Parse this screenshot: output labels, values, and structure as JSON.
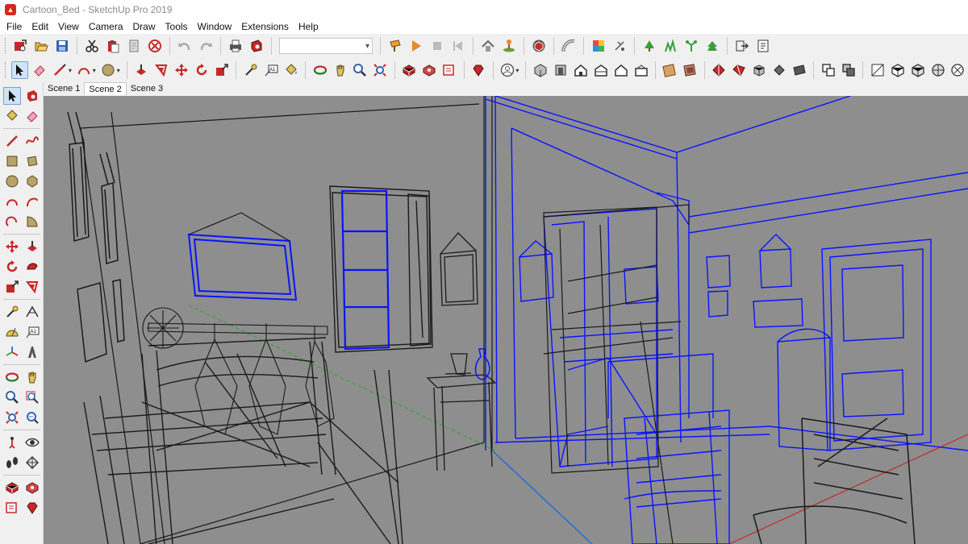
{
  "window": {
    "title": "Cartoon_Bed - SketchUp Pro 2019",
    "app_icon": "sketchup-logo-icon"
  },
  "menu": [
    "File",
    "Edit",
    "View",
    "Camera",
    "Draw",
    "Tools",
    "Window",
    "Extensions",
    "Help"
  ],
  "scenes": [
    {
      "label": "Scene 1",
      "active": false
    },
    {
      "label": "Scene 2",
      "active": true
    },
    {
      "label": "Scene 3",
      "active": false
    }
  ],
  "layer_dropdown": {
    "value": ""
  },
  "toolbar_icons": {
    "row1": [
      "get-models-icon",
      "open-icon",
      "save-icon",
      "cut-icon",
      "paste-icon",
      "erase-icon",
      "delete-icon",
      "undo-icon",
      "redo-icon",
      "print-icon",
      "model-info-icon",
      "layers-icon",
      "section-plane-icon",
      "play-icon",
      "stop-icon",
      "previous-icon",
      "warehouse-icon",
      "location-icon",
      "components-icon",
      "follow-me-icon",
      "styles-icon",
      "shadow-icon",
      "terrain-icon",
      "sandbox-icon",
      "plant-icon",
      "forest-icon",
      "export-icon",
      "report-icon"
    ],
    "row2": [
      "select-icon",
      "eraser-icon",
      "line-icon",
      "arc-icon",
      "shape-icon",
      "push-pull-icon",
      "offset-icon",
      "move-icon",
      "rotate-icon",
      "scale-icon",
      "tape-measure-icon",
      "text-icon",
      "paint-bucket-icon",
      "orbit-icon",
      "pan-icon",
      "zoom-icon",
      "zoom-extents-icon",
      "3d-warehouse-icon",
      "extension-warehouse-icon",
      "send-to-layout-icon",
      "ruby-icon",
      "user-icon",
      "iso-view-icon",
      "top-view-icon",
      "front-view-icon",
      "right-view-icon",
      "back-view-icon",
      "left-view-icon",
      "outliner-icon",
      "materials-icon",
      "fog-icon",
      "xray-icon",
      "back-edges-icon",
      "wireframe-icon",
      "hidden-line-icon",
      "shaded-icon",
      "textured-icon",
      "monochrome-icon",
      "union-icon",
      "subtract-icon",
      "section-display-icon",
      "box-icon",
      "cube-icon",
      "sphere-icon",
      "settings-icon"
    ]
  },
  "colors": {
    "viewport_bg": "#8e8e8e",
    "selection_blue": "#0a14ff",
    "wire_black": "#111111",
    "axis_green": "#2aa52a",
    "axis_blue": "#1e6fd9",
    "axis_red": "#c62828",
    "active_tool_bg": "#cfe3f7"
  }
}
